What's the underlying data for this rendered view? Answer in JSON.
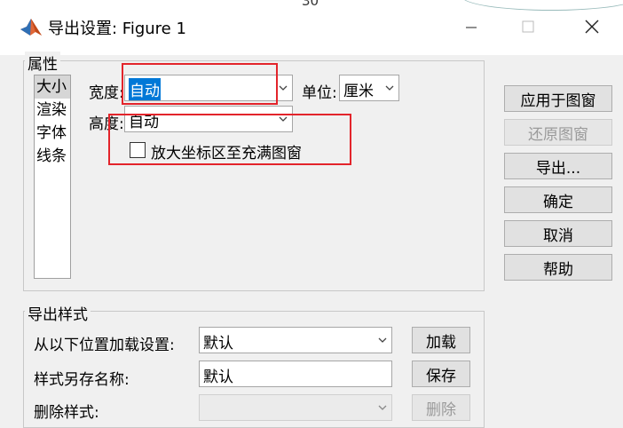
{
  "window": {
    "title": "导出设置: Figure 1",
    "background_axis_tick": "30"
  },
  "properties": {
    "group_label": "属性",
    "categories": [
      {
        "label": "大小",
        "selected": true
      },
      {
        "label": "渲染",
        "selected": false
      },
      {
        "label": "字体",
        "selected": false
      },
      {
        "label": "线条",
        "selected": false
      }
    ],
    "width": {
      "label": "宽度:",
      "value": "自动"
    },
    "height": {
      "label": "高度:",
      "value": "自动"
    },
    "units": {
      "label": "单位:",
      "value": "厘米"
    },
    "expand_axes": {
      "label": "放大坐标区至充满图窗",
      "checked": false
    }
  },
  "side_buttons": {
    "apply": "应用于图窗",
    "restore": "还原图窗",
    "export": "导出...",
    "ok": "确定",
    "cancel": "取消",
    "help": "帮助"
  },
  "export_styles": {
    "group_label": "导出样式",
    "load": {
      "label": "从以下位置加载设置:",
      "value": "默认",
      "button": "加载"
    },
    "save": {
      "label": "样式另存名称:",
      "value": "默认",
      "button": "保存"
    },
    "delete": {
      "label": "删除样式:",
      "value": "",
      "button": "删除"
    }
  },
  "colors": {
    "highlight": "#0078d7",
    "annotation_red": "#e3242b"
  }
}
